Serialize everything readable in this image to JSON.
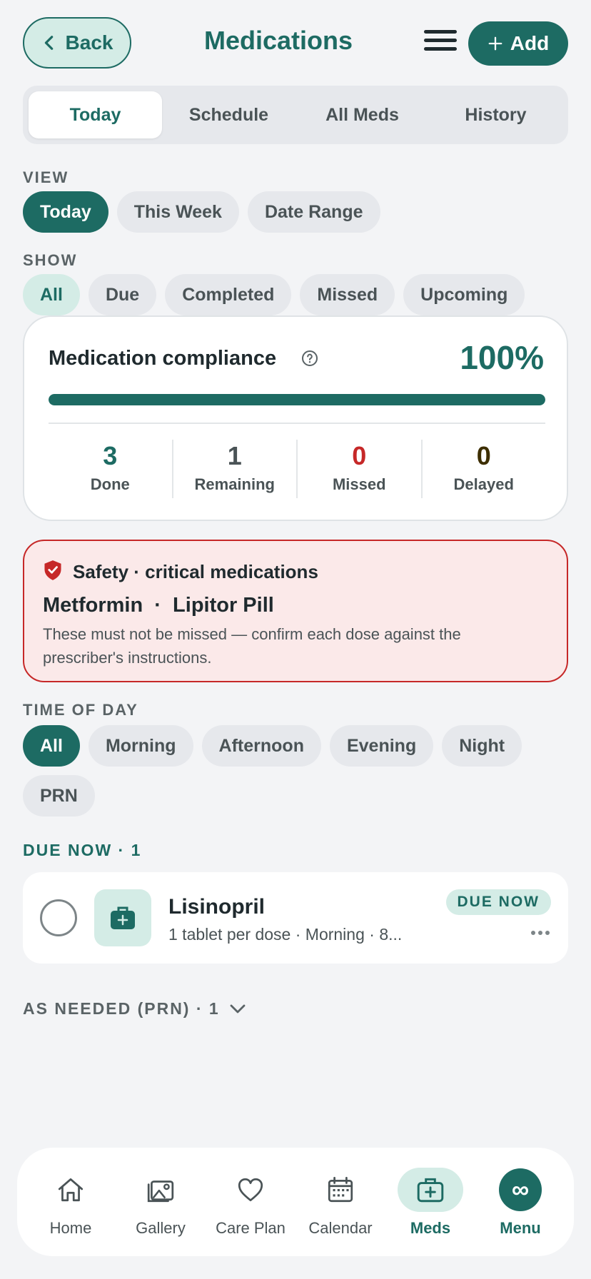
{
  "header": {
    "back_label": "Back",
    "title": "Medications",
    "add_label": "Add"
  },
  "tabs": [
    {
      "label": "Today",
      "active": true
    },
    {
      "label": "Schedule",
      "active": false
    },
    {
      "label": "All Meds",
      "active": false
    },
    {
      "label": "History",
      "active": false
    }
  ],
  "view": {
    "label": "VIEW",
    "options": [
      "Today",
      "This Week",
      "Date Range"
    ],
    "selected": "Today"
  },
  "show": {
    "label": "SHOW",
    "options": [
      "All",
      "Due",
      "Completed",
      "Missed",
      "Upcoming"
    ],
    "selected": "All"
  },
  "compliance": {
    "title": "Medication compliance",
    "percent_label": "100%",
    "progress": 1.0,
    "stats": [
      {
        "value": "3",
        "label": "Done",
        "color": "#1d6b63"
      },
      {
        "value": "1",
        "label": "Remaining",
        "color": "#4a5356"
      },
      {
        "value": "0",
        "label": "Missed",
        "color": "#c62828"
      },
      {
        "value": "0",
        "label": "Delayed",
        "color": "#3d2e00"
      }
    ]
  },
  "safety": {
    "title": "Safety · critical medications",
    "meds": "Metformin  ·  Lipitor Pill",
    "description": "These must not be missed — confirm each dose against the prescriber's instructions."
  },
  "time_of_day": {
    "label": "TIME OF DAY",
    "options": [
      "All",
      "Morning",
      "Afternoon",
      "Evening",
      "Night",
      "PRN"
    ],
    "selected": "All"
  },
  "due_now": {
    "label": "DUE NOW · 1",
    "items": [
      {
        "name": "Lisinopril",
        "subtitle": "1 tablet per dose · Morning · 8...",
        "badge": "DUE NOW"
      }
    ]
  },
  "prn": {
    "label": "AS NEEDED (PRN) · 1"
  },
  "bottom_nav": [
    {
      "label": "Home",
      "icon": "home-icon"
    },
    {
      "label": "Gallery",
      "icon": "gallery-icon"
    },
    {
      "label": "Care Plan",
      "icon": "heart-icon"
    },
    {
      "label": "Calendar",
      "icon": "calendar-icon"
    },
    {
      "label": "Meds",
      "icon": "medkit-icon",
      "active": true
    },
    {
      "label": "Menu",
      "icon": "infinity-icon"
    }
  ],
  "colors": {
    "accent": "#1d6b63",
    "accent_light": "#d4ece6",
    "danger": "#c62828",
    "danger_bg": "#fbe9e9",
    "background": "#f3f4f6"
  }
}
